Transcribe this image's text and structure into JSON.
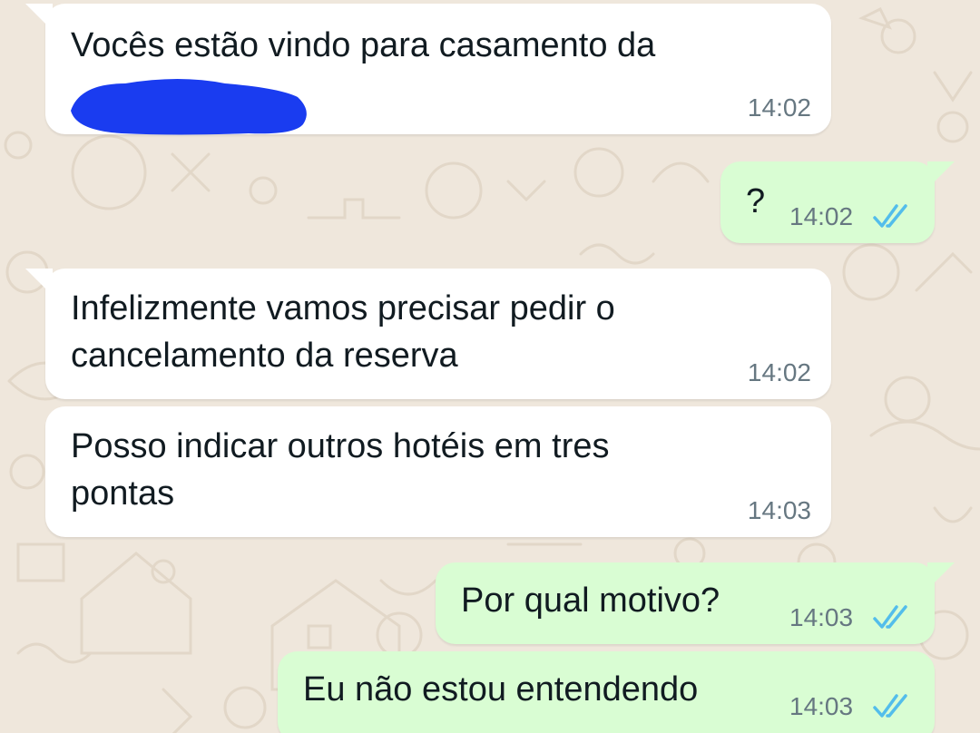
{
  "colors": {
    "wallpaper": "#efe7dc",
    "incoming_bubble": "#ffffff",
    "outgoing_bubble": "#d9fdd3",
    "read_ticks": "#53bdeb",
    "redaction": "#1a3cf0"
  },
  "messages": [
    {
      "direction": "incoming",
      "text": "Vocês estão vindo para casamento da",
      "time": "14:02",
      "redacted": true
    },
    {
      "direction": "outgoing",
      "text": "?",
      "time": "14:02",
      "status": "read"
    },
    {
      "direction": "incoming",
      "text": "Infelizmente vamos precisar pedir o\ncancelamento da reserva",
      "time": "14:02"
    },
    {
      "direction": "incoming",
      "text": "Posso indicar outros hotéis em tres\npontas",
      "time": "14:03"
    },
    {
      "direction": "outgoing",
      "text": "Por qual motivo?",
      "time": "14:03",
      "status": "read"
    },
    {
      "direction": "outgoing",
      "text": "Eu não estou entendendo",
      "time": "14:03",
      "status": "read"
    }
  ]
}
